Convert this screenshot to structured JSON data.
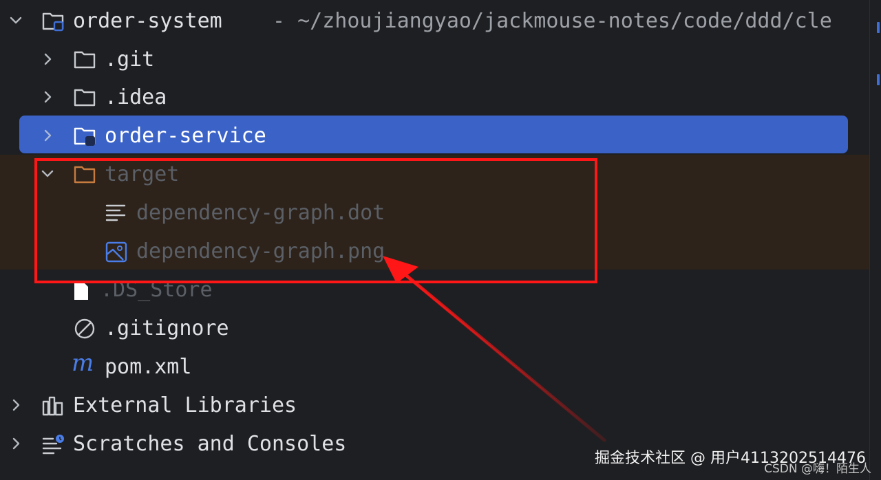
{
  "tree": {
    "root": {
      "name": "order-system",
      "path": "- ~/zhoujiangyao/jackmouse-notes/code/ddd/cle"
    },
    "items": [
      {
        "label": ".git"
      },
      {
        "label": ".idea"
      },
      {
        "label": "order-service"
      },
      {
        "label": "target"
      },
      {
        "label": "dependency-graph.dot"
      },
      {
        "label": "dependency-graph.png"
      },
      {
        "label": ".DS_Store"
      },
      {
        "label": ".gitignore"
      },
      {
        "label": "pom.xml"
      },
      {
        "label": "External Libraries"
      },
      {
        "label": "Scratches and Consoles"
      }
    ]
  },
  "colors": {
    "background": "#1e1f22",
    "selection": "#3a62c7",
    "excluded_band": "#2d231b",
    "excluded_text": "#5b5f66",
    "target_folder": "#c77c3f",
    "annotation_red": "#ff1616"
  },
  "watermark": {
    "line1": "掘金技术社区 @ 用户4113202514476",
    "line2": "CSDN @嗨！陌生人"
  }
}
